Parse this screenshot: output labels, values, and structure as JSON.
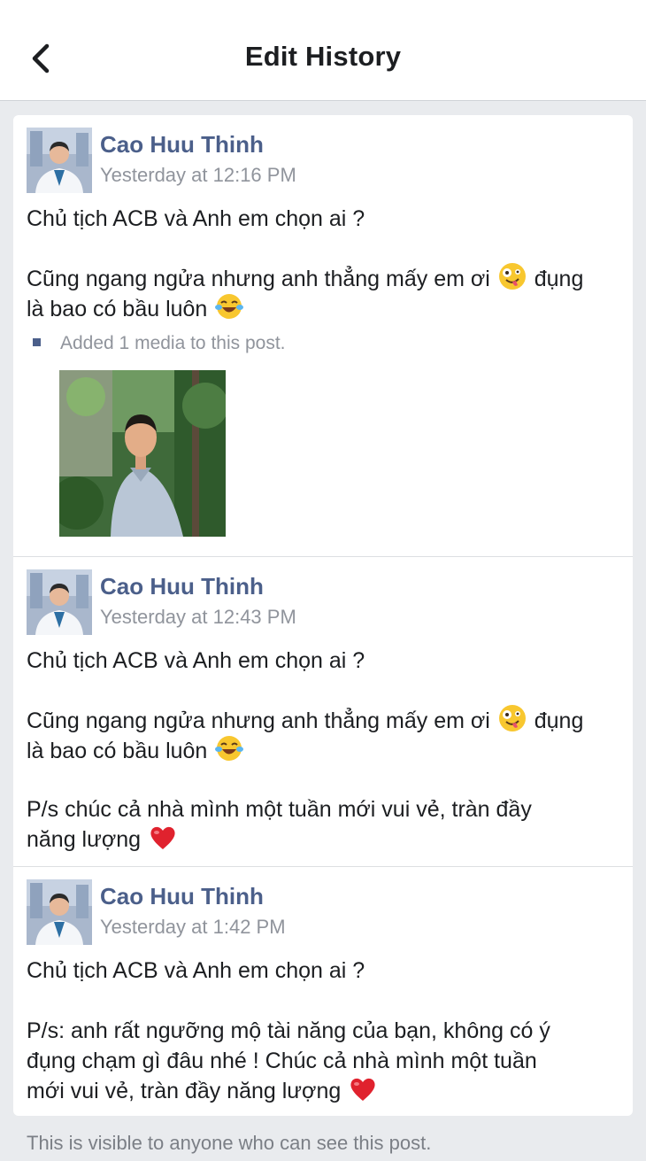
{
  "header": {
    "title": "Edit History",
    "back_icon": "chevron-left-icon"
  },
  "entries": [
    {
      "author": "Cao Huu Thinh",
      "time": "Yesterday at 12:16 PM",
      "line1": "Chủ tịch ACB và Anh em chọn ai ?",
      "line2a": "Cũng ngang ngửa nhưng anh thẳng mấy em ơi",
      "line2b": "đụng",
      "line3": "là bao có bầu luôn",
      "media_note": "Added 1 media to this post."
    },
    {
      "author": "Cao Huu Thinh",
      "time": "Yesterday at 12:43 PM",
      "line1": "Chủ tịch ACB và Anh em chọn ai ?",
      "line2a": "Cũng ngang ngửa nhưng anh thẳng mấy em ơi",
      "line2b": "đụng",
      "line3": "là bao có bầu luôn",
      "line4": "P/s chúc cả nhà mình một tuần mới vui vẻ, tràn đầy",
      "line5": "năng lượng"
    },
    {
      "author": "Cao Huu Thinh",
      "time": "Yesterday at 1:42 PM",
      "line1": "Chủ tịch ACB và Anh em chọn ai ?",
      "line2": "P/s: anh rất ngưỡng mộ tài năng của bạn, không có ý",
      "line3": "đụng chạm gì đâu nhé ! Chúc cả nhà mình một tuần",
      "line4": "mới vui vẻ, tràn đầy năng lượng"
    }
  ],
  "footer": {
    "text": "This is visible to anyone who can see this post."
  },
  "colors": {
    "author": "#4b5f8a",
    "meta": "#90949c",
    "background": "#e9ebee"
  }
}
